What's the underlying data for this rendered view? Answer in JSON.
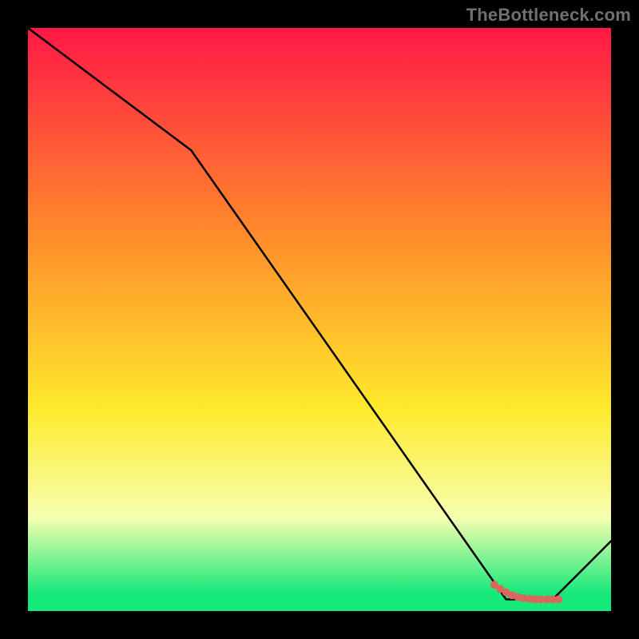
{
  "watermark": "TheBottleneck.com",
  "colors": {
    "background": "#000000",
    "gradient_top": "#ff1846",
    "gradient_mid1": "#ff8a2b",
    "gradient_mid2": "#ffe92b",
    "gradient_mid3": "#f6ffb0",
    "gradient_bottom": "#17e87a",
    "line": "#000000",
    "marker": "#d9675b",
    "watermark": "#707070"
  },
  "chart_data": {
    "type": "line",
    "title": "",
    "xlabel": "",
    "ylabel": "",
    "xlim": [
      0,
      100
    ],
    "ylim": [
      0,
      100
    ],
    "x": [
      0,
      28,
      82,
      90,
      100
    ],
    "values": [
      100,
      79,
      2,
      2,
      12
    ],
    "markers": {
      "x": [
        80,
        81,
        82,
        83,
        84,
        85,
        86,
        87,
        88,
        89,
        90,
        91
      ],
      "y": [
        4.5,
        3.8,
        3.2,
        2.7,
        2.4,
        2.2,
        2.1,
        2.0,
        2.0,
        2.0,
        2.0,
        2.0
      ]
    },
    "gradient_stops": [
      {
        "offset": 0.0,
        "color": "#ff1846"
      },
      {
        "offset": 0.35,
        "color": "#ff8a2b"
      },
      {
        "offset": 0.65,
        "color": "#ffe92b"
      },
      {
        "offset": 0.84,
        "color": "#f6ffb0"
      },
      {
        "offset": 0.97,
        "color": "#17e87a"
      },
      {
        "offset": 1.0,
        "color": "#17e87a"
      }
    ]
  }
}
